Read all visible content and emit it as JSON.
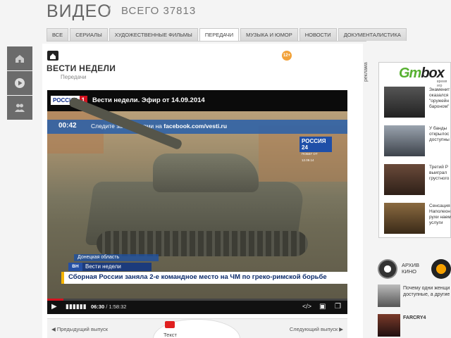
{
  "header": {
    "title": "ВИДЕО",
    "separator": "/",
    "count": "ВСЕГО 37813"
  },
  "tabs": [
    {
      "label": "ВСЕ",
      "active": false
    },
    {
      "label": "СЕРИАЛЫ",
      "active": false
    },
    {
      "label": "ХУДОЖЕСТВЕННЫЕ ФИЛЬМЫ",
      "active": false
    },
    {
      "label": "ПЕРЕДАЧИ",
      "active": true
    },
    {
      "label": "МУЗЫКА И ЮМОР",
      "active": false
    },
    {
      "label": "НОВОСТИ",
      "active": false
    },
    {
      "label": "ДОКУМЕНТАЛИСТИКА",
      "active": false
    }
  ],
  "leftnav": [
    {
      "icon": "home-icon"
    },
    {
      "icon": "play-icon"
    },
    {
      "icon": "users-icon"
    }
  ],
  "program": {
    "title": "ВЕСТИ НЕДЕЛИ",
    "category": "Передачи",
    "age": "12+"
  },
  "player": {
    "channel_name": "РОССИЯ",
    "channel_number": "1",
    "title": "Вести недели. Эфир от 14.09.2014",
    "ticker_time": "00:42",
    "ticker_text": "Следите за новостями на",
    "ticker_link": "facebook.com/vesti.ru",
    "badge_channel": "РОССИЯ 24",
    "badge_sub": "ПОБЕГ ОТ 12.09.14",
    "location": "Донецкая область",
    "show_logo": "ВН",
    "show_name": "Вести недели",
    "news_text": "Сборная России заняла 2-е командное место на ЧМ по греко-римской борьбе",
    "time_current": "06:30",
    "time_total": "1:58:32",
    "progress": 0.055
  },
  "pager": {
    "prev": "Предыдущий выпуск",
    "next": "Следующий выпуск",
    "text": "Текст"
  },
  "ad": {
    "label": "реклама",
    "logo_a": "Gm",
    "logo_b": "box",
    "tag": "время игр",
    "items": [
      {
        "text": "Знаменит оказался \"оружейн бароном\""
      },
      {
        "text": "У банды открылос доступны"
      },
      {
        "text": "Третий Р выиграл грустного"
      },
      {
        "text": "Сенсация Наполеон рухи наем услуги"
      }
    ]
  },
  "sidebar": {
    "archive_label_1": "АРХИВ",
    "archive_label_2": "КИНО",
    "item1": "Почему одни женщи доступные, а другие",
    "item2": "FARCRY4"
  },
  "colors": {
    "accent": "#d4121f",
    "tab_border": "#c8c8c8",
    "nav": "#6b6b6b"
  }
}
